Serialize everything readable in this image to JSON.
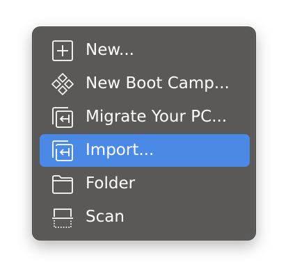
{
  "menu": {
    "items": [
      {
        "label": "New...",
        "icon": "plus-square-icon",
        "selected": false
      },
      {
        "label": "New Boot Camp...",
        "icon": "boot-camp-diamond-icon",
        "selected": false
      },
      {
        "label": "Migrate Your PC...",
        "icon": "migrate-pc-icon",
        "selected": false
      },
      {
        "label": "Import...",
        "icon": "import-icon",
        "selected": true
      },
      {
        "label": "Folder",
        "icon": "folder-icon",
        "selected": false
      },
      {
        "label": "Scan",
        "icon": "scan-icon",
        "selected": false
      }
    ]
  },
  "colors": {
    "menu_background": "#5a5958",
    "selection": "#4a8ae6",
    "text": "#ffffff"
  }
}
